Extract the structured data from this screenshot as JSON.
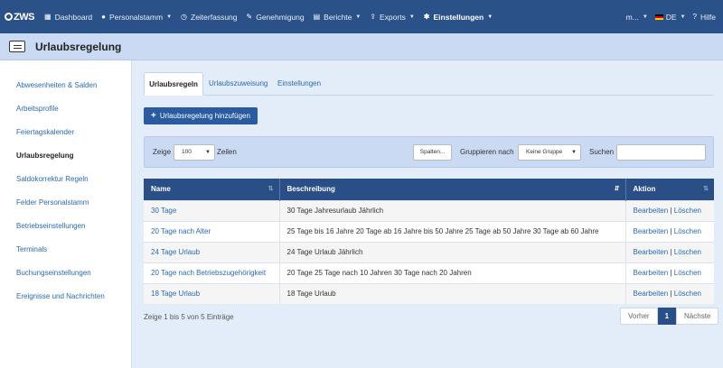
{
  "nav": {
    "brand": "ZWS",
    "items": [
      {
        "label": "Dashboard",
        "icon": "grid-icon"
      },
      {
        "label": "Personalstamm",
        "icon": "person-icon",
        "dropdown": true
      },
      {
        "label": "Zeiterfassung",
        "icon": "clock-icon"
      },
      {
        "label": "Genehmigung",
        "icon": "edit-icon"
      },
      {
        "label": "Berichte",
        "icon": "print-icon",
        "dropdown": true
      },
      {
        "label": "Exports",
        "icon": "export-icon",
        "dropdown": true
      },
      {
        "label": "Einstellungen",
        "icon": "gear-icon",
        "dropdown": true,
        "active": true
      }
    ],
    "user": "m...",
    "language": "DE",
    "help": "Hilfe"
  },
  "page": {
    "title": "Urlaubsregelung"
  },
  "sidebar": {
    "items": [
      {
        "label": "Abwesenheiten & Salden"
      },
      {
        "label": "Arbeitsprofile"
      },
      {
        "label": "Feiertagskalender"
      },
      {
        "label": "Urlaubsregelung",
        "active": true
      },
      {
        "label": "Saldokorrektur Regeln"
      },
      {
        "label": "Felder Personalstamm"
      },
      {
        "label": "Betriebseinstellungen"
      },
      {
        "label": "Terminals"
      },
      {
        "label": "Buchungseinstellungen"
      },
      {
        "label": "Ereignisse und Nachrichten"
      }
    ]
  },
  "tabs": [
    {
      "label": "Urlaubsregeln",
      "active": true
    },
    {
      "label": "Urlaubszuweisung"
    },
    {
      "label": "Einstellungen"
    }
  ],
  "add_button": "Urlaubsregelung hinzufügen",
  "filter": {
    "show_label": "Zeige",
    "page_size": "100",
    "rows_label": "Zeilen",
    "columns_button": "Spalten...",
    "group_label": "Gruppieren nach",
    "group_value": "Keine Gruppe",
    "search_label": "Suchen",
    "search_value": ""
  },
  "table": {
    "headers": [
      "Name",
      "Beschreibung",
      "Aktion"
    ],
    "rows": [
      {
        "name": "30 Tage",
        "description": "30 Tage Jahresurlaub Jährlich"
      },
      {
        "name": "20 Tage nach Alter",
        "description": "25 Tage bis 16 Jahre 20 Tage ab 16 Jahre bis 50 Jahre 25 Tage ab 50 Jahre 30 Tage ab 60 Jahre"
      },
      {
        "name": "24 Tage Urlaub",
        "description": "24 Tage Urlaub Jährlich"
      },
      {
        "name": "20 Tage nach Betriebszugehörigkeit",
        "description": "20 Tage 25 Tage nach 10 Jahren 30 Tage nach 20 Jahren"
      },
      {
        "name": "18 Tage Urlaub",
        "description": "18 Tage Urlaub"
      }
    ],
    "edit_label": "Bearbeiten",
    "separator": "|",
    "delete_label": "Löschen"
  },
  "info": "Zeige 1 bis 5 von 5 Einträge",
  "pager": {
    "prev": "Vorher",
    "current": "1",
    "next": "Nächste"
  },
  "colors": {
    "nav_bg": "#2a5188",
    "accent": "#2a5aa0",
    "link": "#2a6aae",
    "header_bg": "#c9daf2"
  }
}
